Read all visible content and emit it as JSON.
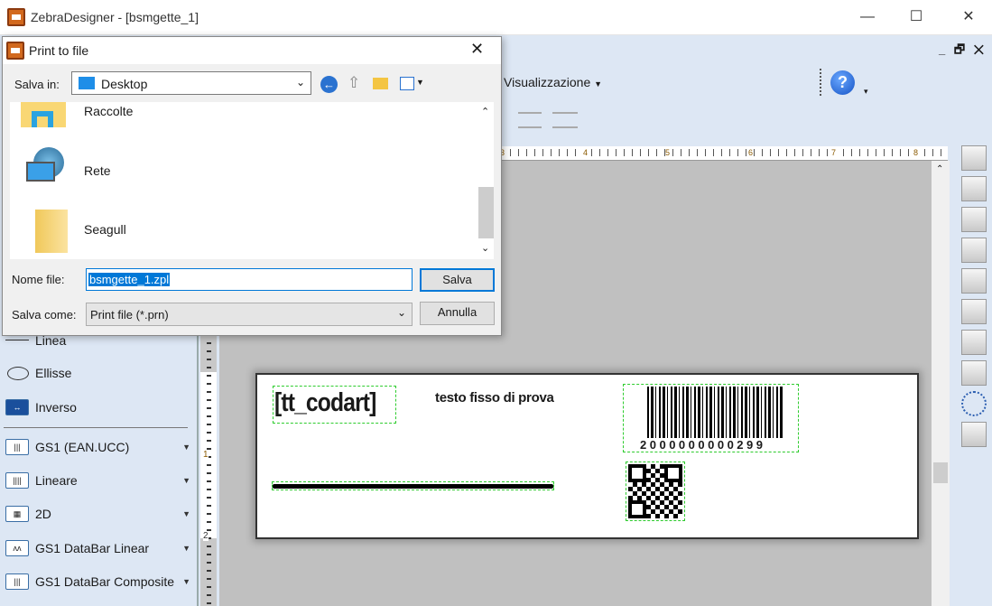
{
  "window": {
    "title": "ZebraDesigner - [bsmgette_1]",
    "minimize": "—",
    "maximize": "☐",
    "close": "✕"
  },
  "mdi": {
    "minimize": "_",
    "restore": "🗗",
    "close": "✕"
  },
  "toolbar": {
    "view_menu": "Visualizzazione",
    "help": "?"
  },
  "ruler": {
    "top": [
      "3",
      "4",
      "5",
      "6",
      "7",
      "8"
    ],
    "left": [
      "1",
      "2"
    ]
  },
  "sidebar": {
    "items": [
      {
        "label": "Linea"
      },
      {
        "label": "Ellisse"
      },
      {
        "label": "Inverso",
        "icon": "↔"
      },
      {
        "label": "GS1 (EAN.UCC)",
        "icon": "|||"
      },
      {
        "label": "Lineare",
        "icon": "||||"
      },
      {
        "label": "2D",
        "icon": "▦"
      },
      {
        "label": "GS1 DataBar Linear",
        "icon": "ᴧᴧ"
      },
      {
        "label": "GS1 DataBar Composite",
        "icon": "|||"
      }
    ]
  },
  "label": {
    "variable": "[tt_codart]",
    "fixed_text": "testo fisso di prova",
    "barcode_number": "2000000000299"
  },
  "dialog": {
    "title": "Print to file",
    "save_in_label": "Salva in:",
    "save_in_value": "Desktop",
    "items": [
      {
        "name": "Raccolte"
      },
      {
        "name": "Rete"
      },
      {
        "name": "Seagull"
      }
    ],
    "filename_label": "Nome file:",
    "filename_value": "bsmgette_1.zpl",
    "save_as_label": "Salva come:",
    "save_as_value": "Print file (*.prn)",
    "save_button": "Salva",
    "cancel_button": "Annulla",
    "close": "✕"
  }
}
